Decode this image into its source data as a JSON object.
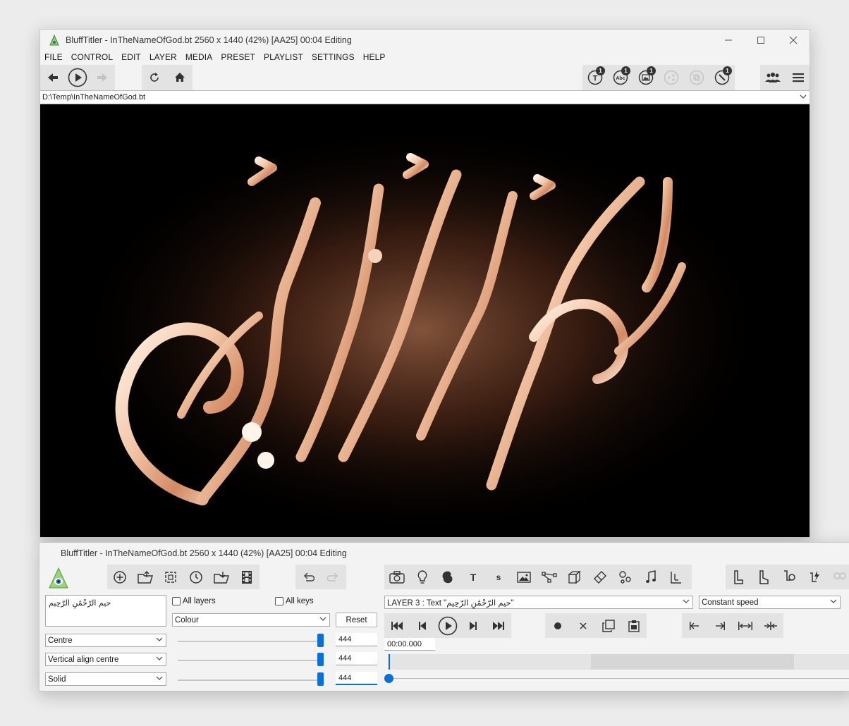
{
  "main_window": {
    "title": "BluffTitler - InTheNameOfGod.bt 2560 x 1440 (42%) [AA25] 00:04 Editing",
    "menu": [
      "FILE",
      "CONTROL",
      "EDIT",
      "LAYER",
      "MEDIA",
      "PRESET",
      "PLAYLIST",
      "SETTINGS",
      "HELP"
    ],
    "path": "D:\\Temp\\InTheNameOfGod.bt",
    "badges": {
      "text": "1",
      "abc": "1",
      "image": "1",
      "brush": "1"
    }
  },
  "control_window": {
    "title": "BluffTitler - InTheNameOfGod.bt 2560 x 1440 (42%) [AA25] 00:04 Editing",
    "text_content": "ﺣﻴﻢ ﺍﻟﺮّﺣْﻤَٰﻦِ ﺍﻟﺮّﺣِﻴﻢ",
    "all_layers_label": "All layers",
    "all_keys_label": "All keys",
    "property_select": "Colour",
    "reset_label": "Reset",
    "align_select": "Centre",
    "valign_select": "Vertical align centre",
    "fill_select": "Solid",
    "values": [
      "444",
      "444",
      "444"
    ],
    "layer_select": "LAYER 3  : Text \"ﺣﻴﻢ ﺍﻟﺮّﺣْﻤَٰﻦِ ﺍﻟﺮّﺣِﻴﻢ\"",
    "speed_select": "Constant speed",
    "time": "00:00.000",
    "text_icon_glyph": "T",
    "s_icon_glyph": "s"
  }
}
